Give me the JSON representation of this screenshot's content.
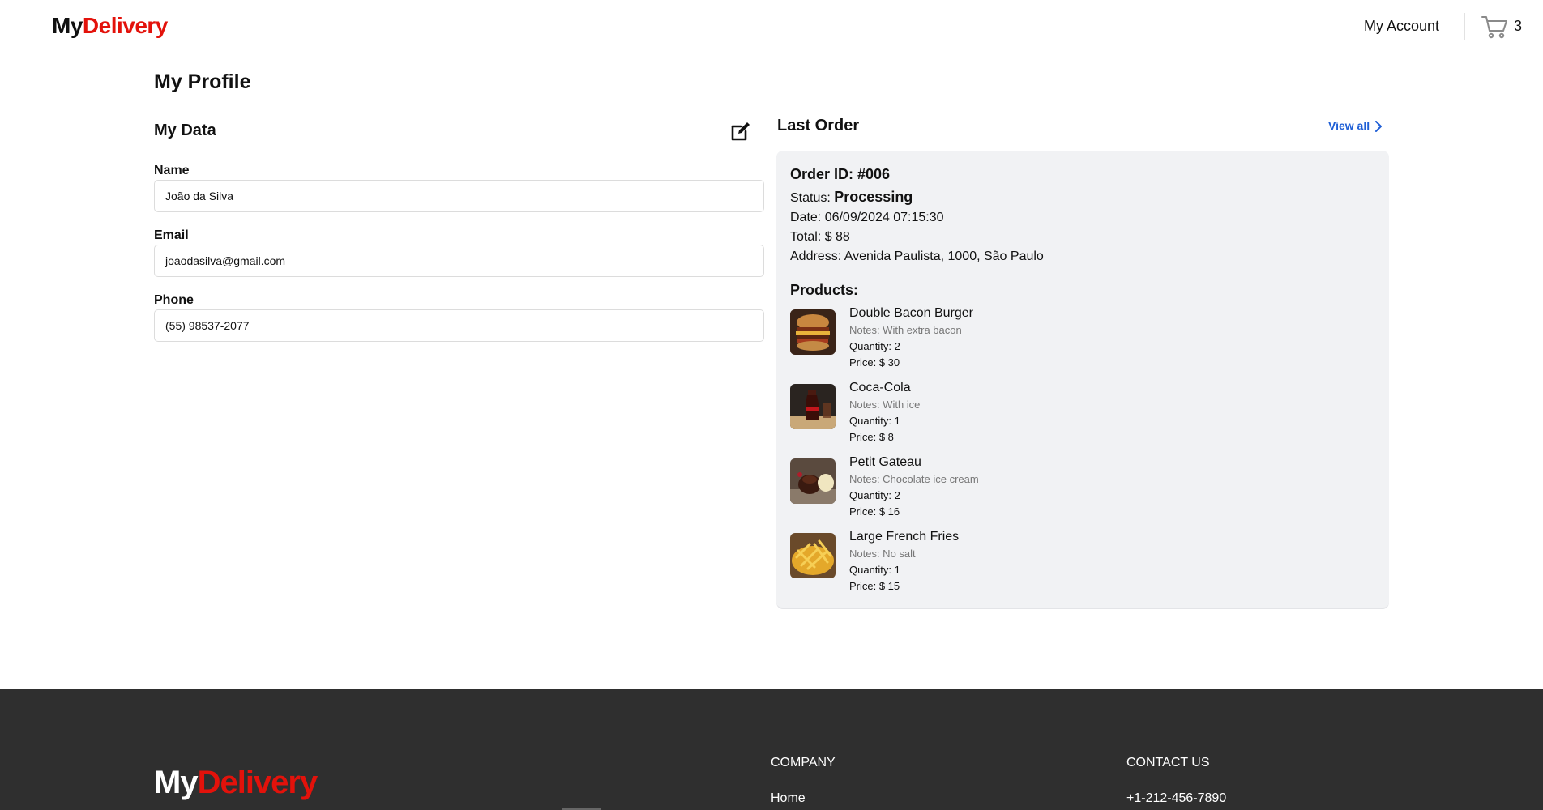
{
  "header": {
    "logo_part1": "My",
    "logo_part2": "Delivery",
    "account_label": "My Account",
    "cart_count": "3"
  },
  "main": {
    "page_title": "My Profile",
    "my_data": {
      "title": "My Data",
      "name_label": "Name",
      "name_value": "João da Silva",
      "email_label": "Email",
      "email_value": "joaodasilva@gmail.com",
      "phone_label": "Phone",
      "phone_value": "(55) 98537-2077"
    },
    "last_order": {
      "title": "Last Order",
      "view_all": "View all",
      "order_id": "Order ID: #006",
      "status_label": "Status:",
      "status_value": "Processing",
      "date": "Date: 06/09/2024 07:15:30",
      "total": "Total: $ 88",
      "address": "Address: Avenida Paulista, 1000, São Paulo",
      "products_title": "Products:",
      "products": [
        {
          "name": "Double Bacon Burger",
          "notes": "Notes: With extra bacon",
          "quantity": "Quantity: 2",
          "price": "Price: $ 30"
        },
        {
          "name": "Coca-Cola",
          "notes": "Notes: With ice",
          "quantity": "Quantity: 1",
          "price": "Price: $ 8"
        },
        {
          "name": "Petit Gateau",
          "notes": "Notes: Chocolate ice cream",
          "quantity": "Quantity: 2",
          "price": "Price: $ 16"
        },
        {
          "name": "Large French Fries",
          "notes": "Notes: No salt",
          "quantity": "Quantity: 1",
          "price": "Price: $ 15"
        }
      ]
    }
  },
  "footer": {
    "logo_part1": "My",
    "logo_part2": "Delivery",
    "company_heading": "COMPANY",
    "company_link": "Home",
    "contact_heading": "CONTACT US",
    "contact_phone": "+1-212-456-7890"
  },
  "colors": {
    "brand_red": "#e3120b",
    "link_blue": "#1f5fd6",
    "footer_bg": "#2f2f2f",
    "card_bg": "#f1f2f4"
  }
}
